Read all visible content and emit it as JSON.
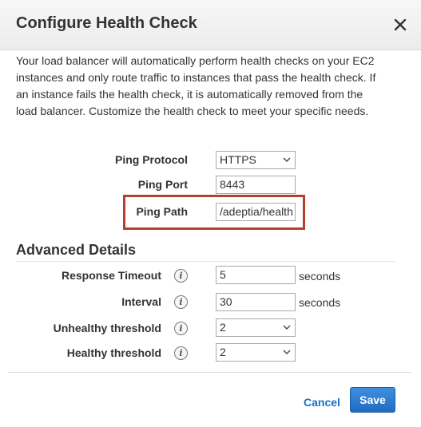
{
  "dialog": {
    "title": "Configure Health Check",
    "description": "Your load balancer will automatically perform health checks on your EC2 instances and only route traffic to instances that pass the health check. If an instance fails the health check, it is automatically removed from the load balancer. Customize the health check to meet your specific needs."
  },
  "ping": {
    "protocol_label": "Ping Protocol",
    "protocol_value": "HTTPS",
    "port_label": "Ping Port",
    "port_value": "8443",
    "path_label": "Ping Path",
    "path_value": "/adeptia/health"
  },
  "advanced": {
    "title": "Advanced Details",
    "response_timeout_label": "Response Timeout",
    "response_timeout_value": "5",
    "response_timeout_unit": "seconds",
    "interval_label": "Interval",
    "interval_value": "30",
    "interval_unit": "seconds",
    "unhealthy_label": "Unhealthy threshold",
    "unhealthy_value": "2",
    "healthy_label": "Healthy threshold",
    "healthy_value": "2",
    "info_glyph": "i"
  },
  "footer": {
    "cancel_label": "Cancel",
    "save_label": "Save"
  },
  "colors": {
    "highlight_border": "#b3412e",
    "primary_button": "#2e7dd1",
    "link": "#1a6fc2"
  },
  "icons": {
    "close": "close-icon",
    "dropdown": "chevron-down-icon",
    "info": "info-icon"
  }
}
